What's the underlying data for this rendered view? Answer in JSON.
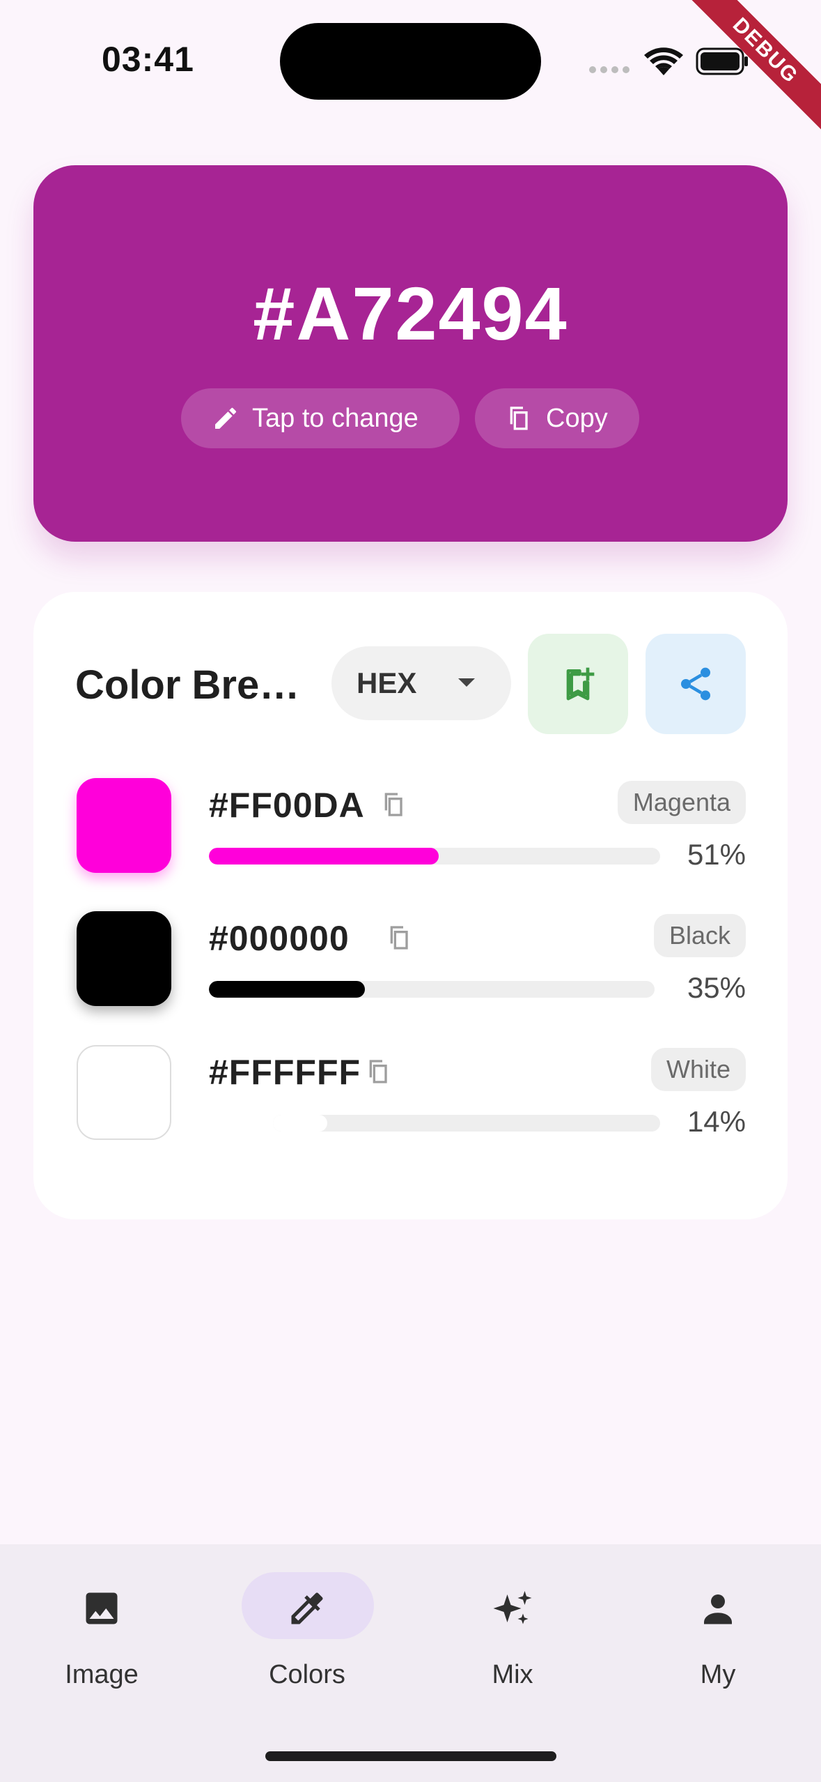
{
  "status_bar": {
    "time": "03:41",
    "debug_label": "DEBUG",
    "icons": [
      "signal-dots-icon",
      "wifi-icon",
      "battery-icon"
    ]
  },
  "hero": {
    "hex": "#A72494",
    "background": "#A72494",
    "change_label": "Tap to change",
    "copy_label": "Copy"
  },
  "breakdown": {
    "title": "Color Bre…",
    "format": "HEX",
    "rows": [
      {
        "hex": "#FF00DA",
        "name": "Magenta",
        "percent": "51%",
        "share": 0.51,
        "color": "#FF00DA"
      },
      {
        "hex": "#000000",
        "name": "Black",
        "percent": "35%",
        "share": 0.35,
        "color": "#000000"
      },
      {
        "hex": "#FFFFFF",
        "name": "White",
        "percent": "14%",
        "share": 0.14,
        "color": "#FFFFFF"
      }
    ]
  },
  "nav": {
    "items": [
      {
        "label": "Image",
        "icon": "image-icon",
        "active": false
      },
      {
        "label": "Colors",
        "icon": "eyedropper-icon",
        "active": true
      },
      {
        "label": "Mix",
        "icon": "sparkles-icon",
        "active": false
      },
      {
        "label": "My",
        "icon": "person-icon",
        "active": false
      }
    ]
  },
  "colors": {
    "accent": "#A72494",
    "save_green": "#3E9B45",
    "share_blue": "#2B8FE0"
  }
}
